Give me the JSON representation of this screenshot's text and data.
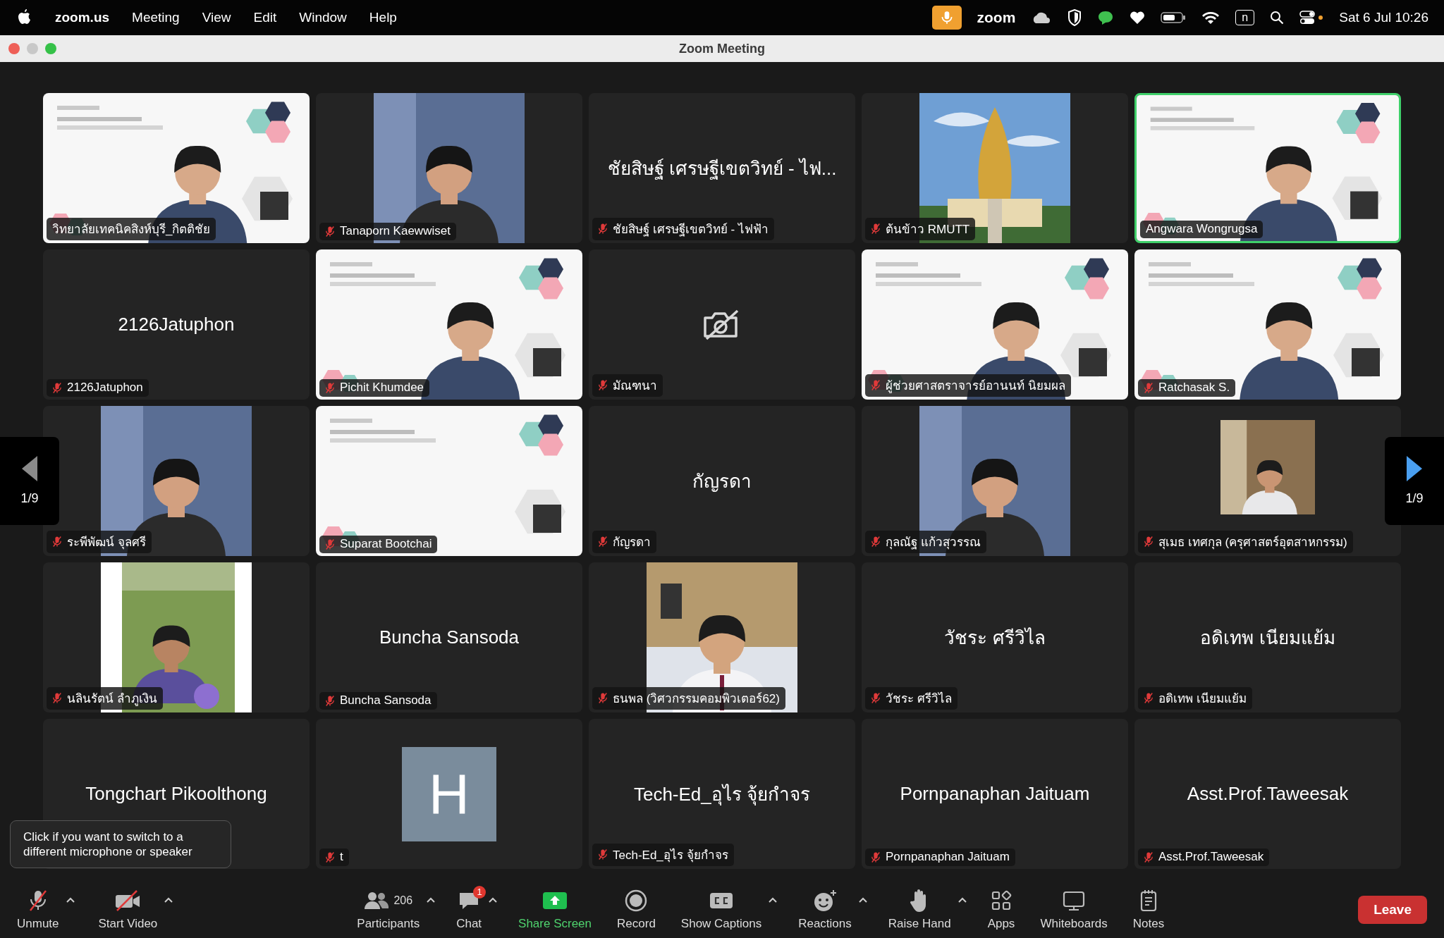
{
  "menu_bar": {
    "app": "zoom.us",
    "menus": [
      "Meeting",
      "View",
      "Edit",
      "Window",
      "Help"
    ],
    "status": {
      "app_word": "zoom",
      "input_source": "n",
      "clock": "Sat 6 Jul  10:26"
    }
  },
  "window": {
    "title": "Zoom Meeting"
  },
  "pager": {
    "previous": {
      "label": "1/9",
      "disabled": true
    },
    "next": {
      "label": "1/9",
      "disabled": false
    }
  },
  "tiles": [
    {
      "kind": "video",
      "name": "วิทยาลัยเทคนิคสิงห์บุรี_กิตติชัย",
      "muted": false,
      "speaking": false
    },
    {
      "kind": "portrait",
      "name": "Tanaporn Kaewwiset",
      "muted": true,
      "speaking": false
    },
    {
      "kind": "name",
      "title": "ชัยสิษฐ์ เศรษฐีเขตวิทย์ - ไฟ...",
      "name": "ชัยสิษฐ์ เศรษฐีเขตวิทย์ - ไฟฟ้า",
      "muted": true,
      "speaking": false
    },
    {
      "kind": "portrait",
      "name": "ต้นข้าว RMUTT",
      "muted": true,
      "speaking": false
    },
    {
      "kind": "video",
      "name": "Angwara Wongrugsa",
      "muted": false,
      "speaking": true
    },
    {
      "kind": "name",
      "title": "2126Jatuphon",
      "name": "2126Jatuphon",
      "muted": true,
      "speaking": false
    },
    {
      "kind": "video",
      "name": "Pichit Khumdee",
      "muted": true,
      "speaking": false
    },
    {
      "kind": "camera_off",
      "name": "มัณฑนา",
      "muted": true,
      "speaking": false
    },
    {
      "kind": "video",
      "name": "ผู้ช่วยศาสตราจารย์อานนท์ นิยมผล",
      "muted": true,
      "speaking": false
    },
    {
      "kind": "video",
      "name": "Ratchasak S.",
      "muted": true,
      "speaking": false
    },
    {
      "kind": "portrait",
      "name": "ระพีพัฒน์ จุลศรี",
      "muted": true,
      "speaking": false
    },
    {
      "kind": "video",
      "name": "Suparat Bootchai",
      "muted": true,
      "speaking": false
    },
    {
      "kind": "name",
      "title": "กัญรดา",
      "name": "กัญรดา",
      "muted": true,
      "speaking": false
    },
    {
      "kind": "portrait",
      "name": "กุลณัฐ แก้วสุวรรณ",
      "muted": true,
      "speaking": false
    },
    {
      "kind": "small",
      "name": "สุเมธ เทศกุล (ครุศาสตร์อุตสาหกรรม)",
      "muted": true,
      "speaking": false
    },
    {
      "kind": "portrait",
      "name": "นลินรัตน์ ลำภูเงิน",
      "muted": true,
      "speaking": false
    },
    {
      "kind": "name",
      "title": "Buncha Sansoda",
      "name": "Buncha Sansoda",
      "muted": true,
      "speaking": false
    },
    {
      "kind": "portrait",
      "name": "ธนพล (วิศวกรรมคอมพิวเตอร์62)",
      "muted": true,
      "speaking": false
    },
    {
      "kind": "name",
      "title": "วัชระ ศรีวิไล",
      "name": "วัชระ ศรีวิไล",
      "muted": true,
      "speaking": false
    },
    {
      "kind": "name",
      "title": "อดิเทพ เนียมแย้ม",
      "name": "อดิเทพ เนียมแย้ม",
      "muted": true,
      "speaking": false
    },
    {
      "kind": "name",
      "title": "Tongchart Pikoolthong",
      "speaking": false
    },
    {
      "kind": "avatar",
      "title": "H",
      "name": "t",
      "muted": true,
      "speaking": false
    },
    {
      "kind": "name",
      "title": "Tech-Ed_อุไร จุ้ยกำจร",
      "name": "Tech-Ed_อุไร จุ้ยกำจร",
      "muted": true,
      "speaking": false
    },
    {
      "kind": "name",
      "title": "Pornpanaphan Jaituam",
      "name": "Pornpanaphan Jaituam",
      "muted": true,
      "speaking": false
    },
    {
      "kind": "name",
      "title": "Asst.Prof.Taweesak",
      "name": "Asst.Prof.Taweesak",
      "muted": true,
      "speaking": false
    }
  ],
  "tooltip": "Click if you want to switch to a different microphone or speaker",
  "toolbar": {
    "items": [
      {
        "kind": "mic",
        "label": "Unmute",
        "menu": true
      },
      {
        "kind": "video",
        "label": "Start Video",
        "menu": true
      },
      {
        "kind": "participants",
        "label": "Participants",
        "count": "206",
        "menu": true
      },
      {
        "kind": "chat",
        "label": "Chat",
        "badge": "1",
        "menu": true
      },
      {
        "kind": "share",
        "label": "Share Screen",
        "menu": false
      },
      {
        "kind": "record",
        "label": "Record",
        "menu": false
      },
      {
        "kind": "captions",
        "label": "Show Captions",
        "menu": true
      },
      {
        "kind": "reactions",
        "label": "Reactions",
        "menu": true
      },
      {
        "kind": "hand",
        "label": "Raise Hand",
        "menu": true
      },
      {
        "kind": "apps",
        "label": "Apps",
        "menu": false
      },
      {
        "kind": "whiteboards",
        "label": "Whiteboards",
        "menu": false
      },
      {
        "kind": "notes",
        "label": "Notes",
        "menu": false
      }
    ],
    "leave": "Leave"
  }
}
